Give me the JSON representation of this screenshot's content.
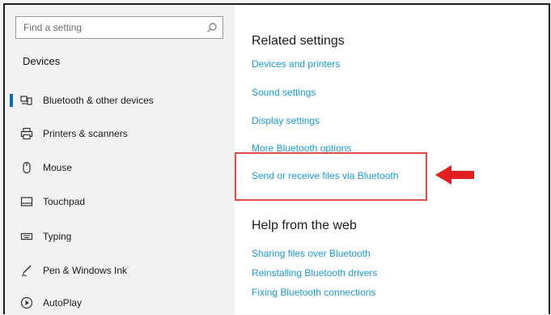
{
  "search": {
    "placeholder": "Find a setting",
    "icon": "search-icon"
  },
  "sidebar": {
    "title": "Devices",
    "items": [
      {
        "label": "Bluetooth & other devices",
        "icon": "bluetooth-devices-icon",
        "selected": true
      },
      {
        "label": "Printers & scanners",
        "icon": "printer-icon"
      },
      {
        "label": "Mouse",
        "icon": "mouse-icon"
      },
      {
        "label": "Touchpad",
        "icon": "touchpad-icon"
      },
      {
        "label": "Typing",
        "icon": "keyboard-icon"
      },
      {
        "label": "Pen & Windows Ink",
        "icon": "pen-icon"
      },
      {
        "label": "AutoPlay",
        "icon": "autoplay-icon"
      }
    ]
  },
  "main": {
    "related_title": "Related settings",
    "related_links": [
      "Devices and printers",
      "Sound settings",
      "Display settings",
      "More Bluetooth options",
      "Send or receive files via Bluetooth"
    ],
    "help_title": "Help from the web",
    "help_links": [
      "Sharing files over Bluetooth",
      "Reinstalling Bluetooth drivers",
      "Fixing Bluetooth connections"
    ]
  },
  "colors": {
    "link": "#1a9ad6",
    "highlight_box": "#e34a4a",
    "arrow": "#e02020",
    "accent": "#0f6cbd"
  }
}
